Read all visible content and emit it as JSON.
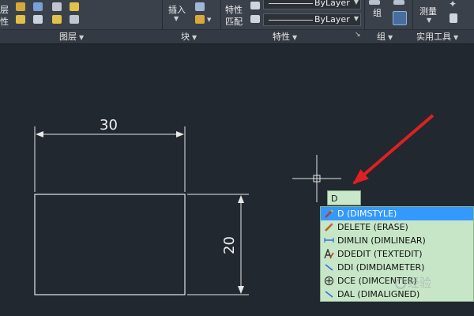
{
  "ribbon": {
    "layers_left_text": [
      "层",
      "性"
    ],
    "insert_label": "插入",
    "match_props_label": [
      "特性",
      "匹配"
    ],
    "combo_values": [
      "ByLayer",
      "ByLayer"
    ],
    "group_label": "组",
    "measure_label": "测量",
    "panel_titles": [
      "图层",
      "块",
      "特性",
      "组",
      "实用工具"
    ]
  },
  "drawing": {
    "horizontal_dimension": "30",
    "vertical_dimension": "20"
  },
  "command": {
    "input_value": "D",
    "autocomplete": [
      {
        "label": "D (DIMSTYLE)",
        "icon": "dimstyle-icon",
        "selected": true
      },
      {
        "label": "DELETE (ERASE)",
        "icon": "erase-icon",
        "selected": false
      },
      {
        "label": "DIMLIN (DIMLINEAR)",
        "icon": "dimlinear-icon",
        "selected": false
      },
      {
        "label": "DDEDIT (TEXTEDIT)",
        "icon": "textedit-icon",
        "selected": false
      },
      {
        "label": "DDI (DIMDIAMETER)",
        "icon": "dimdiameter-icon",
        "selected": false
      },
      {
        "label": "DCE (DIMCENTER)",
        "icon": "dimcenter-icon",
        "selected": false
      },
      {
        "label": "DAL (DIMALIGNED)",
        "icon": "dimaligned-icon",
        "selected": false
      }
    ]
  },
  "watermark": "经验",
  "colors": {
    "canvas": "#212830",
    "ribbon": "#3b414b",
    "highlight": "#3399ff",
    "autocomplete_bg": "#c7e6c7",
    "arrow": "#e02020"
  }
}
